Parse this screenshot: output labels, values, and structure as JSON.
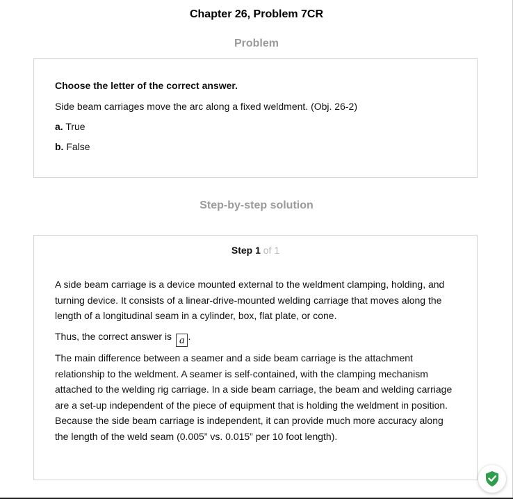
{
  "header": {
    "title": "Chapter 26, Problem 7CR"
  },
  "problem": {
    "heading": "Problem",
    "instruction": "Choose the letter of the correct answer.",
    "question": "Side beam carriages move the arc along a fixed weldment. (Obj. 26-2)",
    "options": [
      {
        "letter": "a.",
        "text": "True"
      },
      {
        "letter": "b.",
        "text": "False"
      }
    ]
  },
  "solution": {
    "heading": "Step-by-step solution",
    "step_label": "Step 1",
    "step_count": "of 1",
    "paragraph_1": "A side beam carriage is a device mounted external to the weldment clamping, holding, and turning device. It consists of a linear-drive-mounted welding carriage that moves along the length of a longitudinal seam in a cylinder, box, flat plate, or cone.",
    "answer_prefix": "Thus, the correct answer is",
    "answer_value": "a",
    "answer_suffix": ".",
    "paragraph_2": "The main difference between a seamer and a side beam carriage is the attachment relationship to the weldment. A seamer is self-contained, with the clamping mechanism attached to the welding rig carriage. In a side beam carriage, the beam and welding carriage are a set-up independent of the piece of equipment that is holding the weldment in position. Because the side beam carriage is independent, it can provide much more accuracy along the length of the weld seam (0.005” vs. 0.015” per 10 foot length)."
  },
  "badge": {
    "icon": "shield-check-icon",
    "color": "#2e9e4a"
  }
}
